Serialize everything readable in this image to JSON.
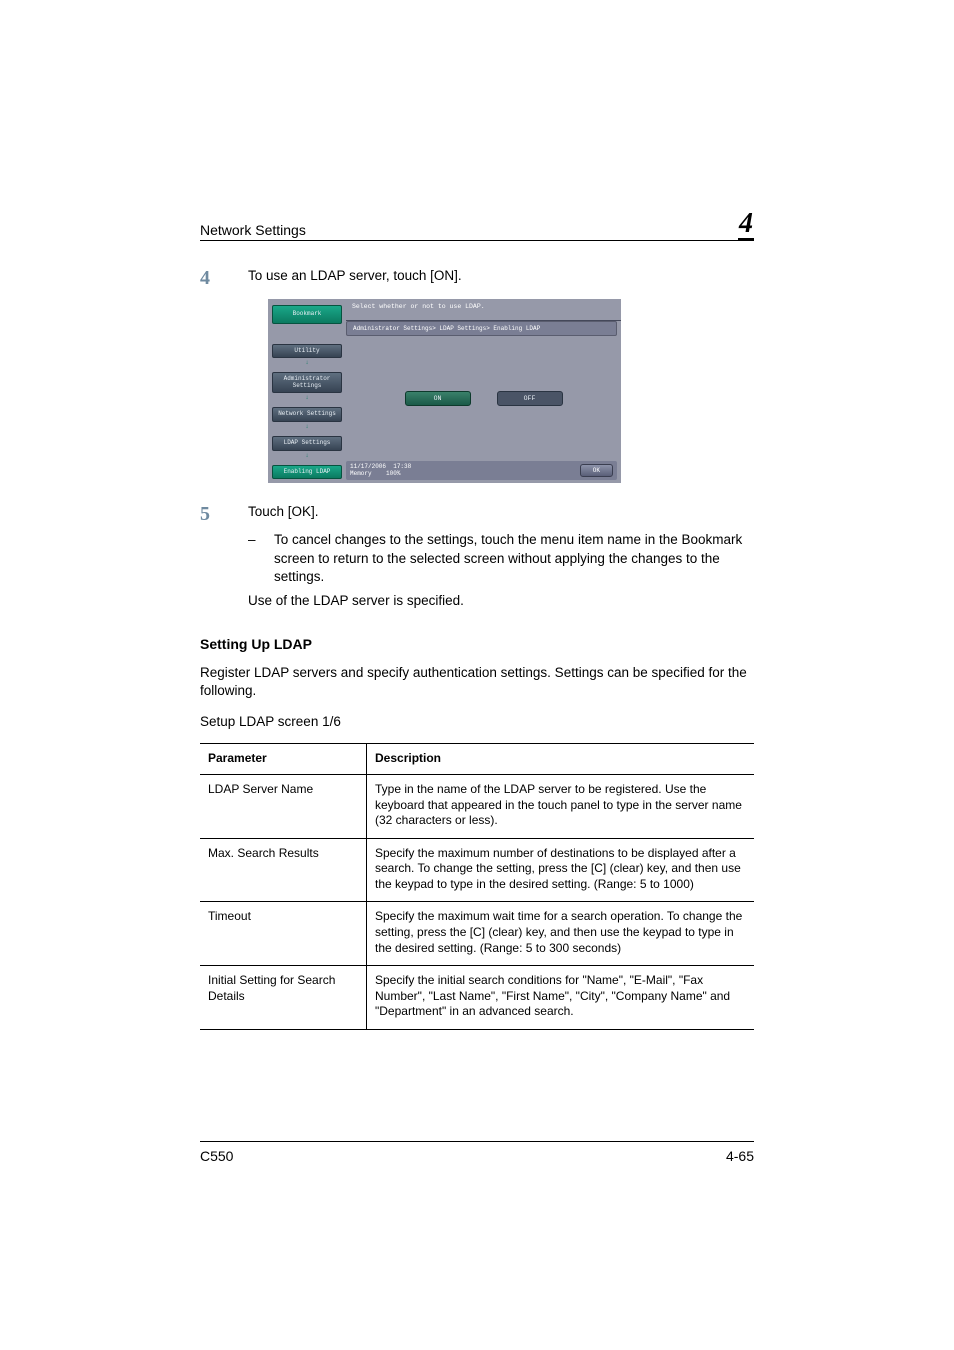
{
  "header": {
    "title": "Network Settings",
    "chapter_number": "4"
  },
  "step4": {
    "num": "4",
    "text": "To use an LDAP server, touch [ON]."
  },
  "screenshot": {
    "top_message": "Select whether or not to use LDAP.",
    "breadcrumb": "Administrator Settings> LDAP Settings> Enabling LDAP",
    "bookmark": "Bookmark",
    "nav": [
      "Utility",
      "Administrator Settings",
      "Network Settings",
      "LDAP Settings",
      "Enabling LDAP"
    ],
    "option_on": "ON",
    "option_off": "OFF",
    "date": "11/17/2006",
    "time": "17:38",
    "memory_label": "Memory",
    "memory_val": "100%",
    "ok": "OK"
  },
  "step5": {
    "num": "5",
    "text": "Touch [OK].",
    "dash": "–",
    "sub": "To cancel changes to the settings, touch the menu item name in the Bookmark screen to return to the selected screen without applying the changes to the settings.",
    "result": "Use of the LDAP server is specified."
  },
  "section": {
    "heading": "Setting Up LDAP",
    "text1": "Register LDAP servers and specify authentication settings. Settings can be specified for the following.",
    "text2": "Setup LDAP screen 1/6"
  },
  "table": {
    "head": {
      "param": "Parameter",
      "desc": "Description"
    },
    "rows": [
      {
        "param": "LDAP Server Name",
        "desc": "Type in the name of the LDAP server to be registered.\nUse the keyboard that appeared in the touch panel to type in the server name (32 characters or less)."
      },
      {
        "param": "Max. Search Results",
        "desc": "Specify the maximum number of destinations to be displayed after a search. To change the setting, press the [C] (clear) key, and then use the keypad to type in the desired setting. (Range: 5 to 1000)"
      },
      {
        "param": "Timeout",
        "desc": "Specify the maximum wait time for a search operation. To change the setting, press the [C] (clear) key, and then use the keypad to type in the desired setting. (Range: 5 to 300 seconds)"
      },
      {
        "param": "Initial Setting for Search Details",
        "desc": "Specify the initial search conditions for \"Name\", \"E-Mail\", \"Fax Number\", \"Last Name\", \"First Name\", \"City\", \"Company Name\" and \"Department\" in an advanced search."
      }
    ]
  },
  "footer": {
    "model": "C550",
    "page": "4-65"
  },
  "chart_data": {
    "type": "table",
    "title": "Setup LDAP screen 1/6 parameters",
    "columns": [
      "Parameter",
      "Description"
    ],
    "rows": [
      [
        "LDAP Server Name",
        "Type in the name of the LDAP server to be registered. Use the keyboard that appeared in the touch panel to type in the server name (32 characters or less)."
      ],
      [
        "Max. Search Results",
        "Specify the maximum number of destinations to be displayed after a search. To change the setting, press the [C] (clear) key, and then use the keypad to type in the desired setting. (Range: 5 to 1000)"
      ],
      [
        "Timeout",
        "Specify the maximum wait time for a search operation. To change the setting, press the [C] (clear) key, and then use the keypad to type in the desired setting. (Range: 5 to 300 seconds)"
      ],
      [
        "Initial Setting for Search Details",
        "Specify the initial search conditions for \"Name\", \"E-Mail\", \"Fax Number\", \"Last Name\", \"First Name\", \"City\", \"Company Name\" and \"Department\" in an advanced search."
      ]
    ]
  }
}
